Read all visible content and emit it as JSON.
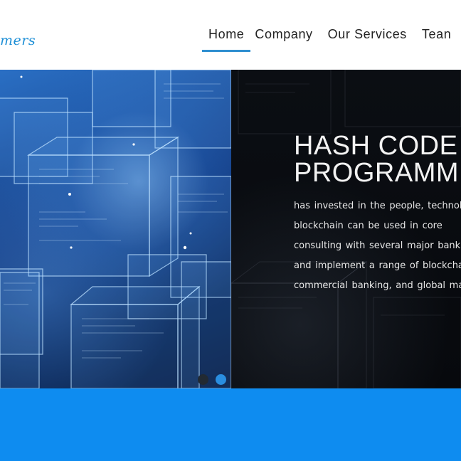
{
  "header": {
    "logo_text": "mers",
    "nav": [
      {
        "label": "Home",
        "active": true
      },
      {
        "label": "Company",
        "active": false
      },
      {
        "label": "Our Services",
        "active": false
      },
      {
        "label": "Tean",
        "active": false
      }
    ]
  },
  "hero": {
    "title_line1": "HASH CODE",
    "title_line2": "PROGRAMM",
    "paragraph_lines": [
      "has invested in the people, technolo",
      "blockchain  can  be  used  in  core",
      "consulting with several major bankin",
      "and implement a range of blockchain-",
      "commercial banking, and global mark"
    ],
    "carousel": {
      "slides": 2,
      "active_index": 1
    }
  },
  "colors": {
    "accent": "#2f8fd0",
    "logo": "#1e8fd6",
    "band": "#0e8cf0",
    "dot_active": "#2a8ee0",
    "dot_inactive": "#222a33"
  },
  "icons": [
    "carousel-dot-icon"
  ]
}
